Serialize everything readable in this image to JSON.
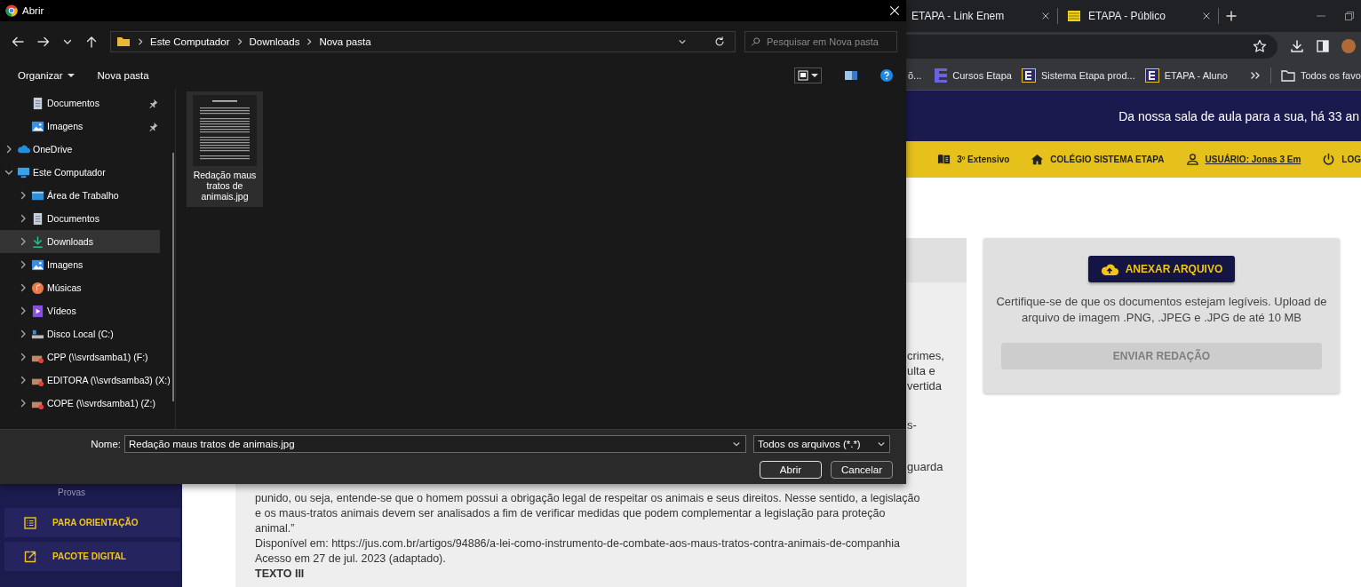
{
  "dialog": {
    "title": "Abrir",
    "path": [
      "Este Computador",
      "Downloads",
      "Nova pasta"
    ],
    "search": {
      "placeholder": "Pesquisar em Nova pasta"
    },
    "toolbar": [
      {
        "label": "Organizar",
        "kind": "menu"
      },
      {
        "label": "Nova pasta",
        "kind": "button"
      }
    ],
    "tree": [
      {
        "label": "Documentos",
        "kind": "documents",
        "pinned": true,
        "selected": false
      },
      {
        "label": "Imagens",
        "kind": "pictures",
        "pinned": true,
        "selected": false
      },
      {
        "label": "OneDrive",
        "kind": "cloud",
        "pinned": false,
        "expanded": false,
        "selected": false
      },
      {
        "label": "Este Computador",
        "kind": "computer",
        "pinned": false,
        "expanded": true,
        "selected": false,
        "children": [
          {
            "label": "Área de Trabalho",
            "kind": "desktop",
            "expanded": false,
            "selected": false
          },
          {
            "label": "Documentos",
            "kind": "documents",
            "expanded": false,
            "selected": false
          },
          {
            "label": "Downloads",
            "kind": "download",
            "expanded": false,
            "selected": true
          },
          {
            "label": "Imagens",
            "kind": "pictures",
            "expanded": false,
            "selected": false
          },
          {
            "label": "Músicas",
            "kind": "music",
            "expanded": false,
            "selected": false
          },
          {
            "label": "Vídeos",
            "kind": "video",
            "expanded": false,
            "selected": false
          },
          {
            "label": "Disco Local (C:)",
            "kind": "disk",
            "expanded": false,
            "selected": false
          },
          {
            "label": "CPP (\\\\svrdsamba1) (F:)",
            "kind": "network",
            "expanded": false,
            "selected": false
          },
          {
            "label": "EDITORA (\\\\svrdsamba3) (X:)",
            "kind": "network",
            "expanded": false,
            "selected": false
          },
          {
            "label": "COPE (\\\\svrdsamba1) (Z:)",
            "kind": "network",
            "expanded": false,
            "selected": false
          }
        ]
      }
    ],
    "files": [
      {
        "name": "Redação maus tratos de animais.jpg",
        "selected": true
      }
    ],
    "name_label": "Nome:",
    "file_name": "Redação maus tratos de animais.jpg",
    "file_type": "Todos os arquivos (*.*)",
    "buttons": [
      {
        "label": "Abrir",
        "default": true
      },
      {
        "label": "Cancelar",
        "default": false
      }
    ]
  },
  "browser": {
    "tabs": [
      {
        "label": "ETAPA - Link Enem",
        "kind": "plain"
      },
      {
        "label": "ETAPA - Público",
        "kind": "site"
      }
    ],
    "bookmarks": [
      {
        "label": "õ...",
        "kind": "plain"
      },
      {
        "label": "Cursos Etapa",
        "kind": "letter"
      },
      {
        "label": "Sistema Etapa prod...",
        "kind": "framed"
      },
      {
        "label": "ETAPA - Aluno",
        "kind": "framed"
      },
      {
        "label": "Todos os favo",
        "kind": "folder"
      }
    ]
  },
  "site": {
    "slogan": "Da nossa sala de aula para a sua, há 33 an",
    "nav": [
      {
        "label": "3º Extensivo",
        "kind": "book"
      },
      {
        "label": "COLÉGIO SISTEMA ETAPA",
        "kind": "home"
      },
      {
        "label": "USUÁRIO: Jonas 3 Em",
        "kind": "user"
      },
      {
        "label": "LOG",
        "kind": "power"
      }
    ],
    "sidebar": [
      {
        "label": "Provas",
        "kind": "sublink"
      },
      {
        "label": "PARA ORIENTAÇÃO",
        "kind": "list"
      },
      {
        "label": "PACOTE DIGITAL",
        "kind": "external"
      }
    ],
    "essay": {
      "fragments": [
        [
          "crimes,",
          "ulta e",
          "vertida"
        ],
        [
          "s-"
        ],
        [
          "guarda"
        ]
      ],
      "lines": [
        "punido, ou seja, entende-se que o homem possui a obrigação legal de respeitar os animais e seus direitos. Nesse sentido, a legislação",
        "e os maus-tratos animais devem ser analisados a fim de verificar medidas que podem complementar a legislação para proteção",
        "animal.”",
        "Disponível em: https://jus.com.br/artigos/94886/a-lei-como-instrumento-de-combate-aos-maus-tratos-contra-animais-de-companhia",
        "Acesso em 27 de jul. 2023 (adaptado)."
      ],
      "heading": "TEXTO III"
    },
    "upload": {
      "button": "ANEXAR ARQUIVO",
      "note": "Certifique-se de que os documentos estejam legíveis. Upload de arquivo de imagem .PNG, .JPEG e .JPG de até 10 MB",
      "submit": {
        "label": "ENVIAR REDAÇÃO",
        "disabled": true
      }
    }
  }
}
